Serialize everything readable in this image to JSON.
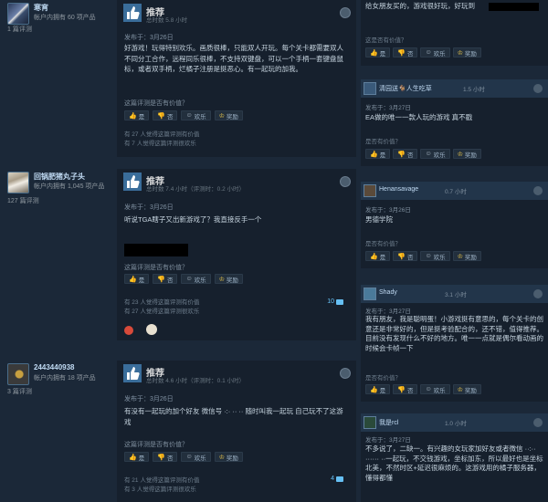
{
  "common": {
    "recommended": "推荐",
    "helpful_question": "这篇评测是否有价值？",
    "btn_yes": "是",
    "btn_no": "否",
    "btn_funny": "欢乐",
    "btn_award": "奖励"
  },
  "reviews": [
    {
      "username": "寒宵",
      "products": "帐户内拥有 60 项产品",
      "review_count": "1 篇评测",
      "time": "总时数 5.8 小时",
      "date": "发布于：3月26日",
      "text": "好游戏！玩得特别欢乐。画质很棒，只能双人开玩。每个关卡都需要双人不同分工合作，远程同乐很棒，不支持双键盘，可以一个手柄一套键盘鼠标，或者双手柄，烂橘子注册是挺恶心。有一起玩的加我。",
      "helpful1": "有 27 人觉得这篇评测有价值",
      "helpful2": "有 7 人觉得这篇评测很欢乐"
    },
    {
      "username": "回锅肥猪丸子头",
      "products": "帐户内拥有 1,045 项产品",
      "review_count": "127 篇评测",
      "time": "总时数 7.4 小时（评测时：0.2 小时）",
      "date": "发布于：3月26日",
      "text": "听说TGA瞎子又出新游戏了？我直接反手一个",
      "helpful1": "有 23 人觉得这篇评测有价值",
      "helpful2": "有 27 人觉得这篇评测很欢乐",
      "comments": "10"
    },
    {
      "username": "2443440938",
      "products": "帐户内拥有 18 项产品",
      "review_count": "3 篇评测",
      "time": "总时数 4.6 小时（评测时：0.1 小时）",
      "date": "发布于：3月26日",
      "text": "有没有一起玩的加个好友 微信号 ·:· ·· ·· 随时叫我一起玩 自己玩不了这游戏",
      "helpful1": "有 21 人觉得这篇评测有价值",
      "helpful2": "有 3 人觉得这篇评测很欢乐",
      "comments": "4"
    }
  ],
  "side": [
    {
      "text": "给女朋友买的，游戏很好玩，好玩到",
      "helpful_q": "这是否有价值？"
    },
    {
      "name": "清园送🐐人生吃草",
      "hrs": "1.5 小时",
      "date": "发布于：3月27日",
      "text": "EA做的唯一一款人玩的游戏 真不戳",
      "helpful_q": "是否有价值？"
    },
    {
      "name": "Henansavage",
      "hrs": "0.7 小时",
      "date": "发布于：3月26日",
      "text": "男德学院",
      "helpful_q": "是否有价值？"
    },
    {
      "name": "Shady",
      "hrs": "3.1 小时",
      "date": "发布于：3月27日",
      "text": "我有朋友，我是聪明蛋！小游戏挺有意思的，每个关卡的创意还是非常好的，但是挺考验配合的，还不错，值得推荐。目前没有发现什么不好的地方。唯一一点就是偶尔看动画的时候会卡帧一下",
      "helpful_q": "是否有价值？"
    },
    {
      "name": "我是rcl",
      "hrs": "1.0 小时",
      "date": "发布于：3月27日",
      "text": "不多说了，二缺一。有兴趣的女玩家加好友或者微信 ··:·· ······ ··一起玩，不交钱游戏，坐标加东，所以最好也是坐标北美，不然时区+延迟很麻烦的。这游戏用的橘子服务器，懂得都懂",
      "helpful_q": ""
    }
  ]
}
